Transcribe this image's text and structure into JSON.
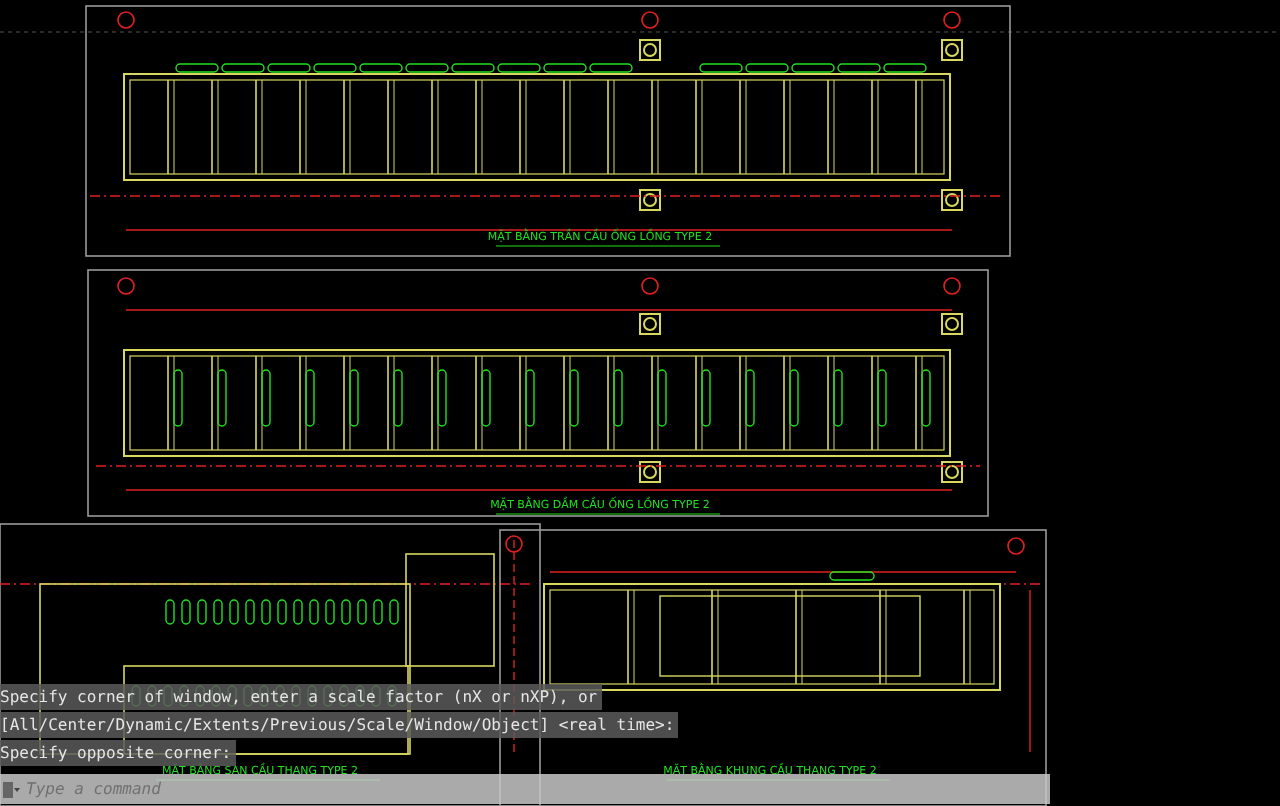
{
  "sheets": [
    {
      "title": "MẶT BẰNG TRẦN CẦU ỐNG LỒNG TYPE 2"
    },
    {
      "title": "MẶT BẰNG DẦM CẦU ỐNG LỒNG TYPE 2"
    },
    {
      "title": "MẶT BẰNG SÀN CẦU THANG TYPE 2"
    },
    {
      "title": "MẶT BẰNG KHUNG CẦU THANG TYPE 2"
    }
  ],
  "command_history": [
    "Specify corner of window, enter a scale factor (nX or nXP), or",
    "[All/Center/Dynamic/Extents/Previous/Scale/Window/Object] <real time>:",
    "Specify opposite corner:"
  ],
  "command_line": {
    "placeholder": "Type a command"
  }
}
